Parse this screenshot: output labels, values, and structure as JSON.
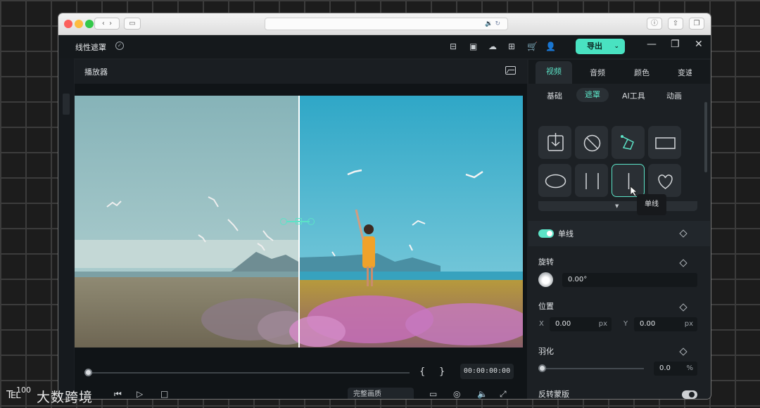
{
  "browser": {
    "url_icons": "🔉 ↻"
  },
  "app": {
    "title": "线性遮罩",
    "export_label": "导出",
    "export_chevron": "⌄"
  },
  "player": {
    "title": "播放器",
    "timecode": "00:00:00:00",
    "brace_left": "{",
    "brace_right": "}",
    "quality": "完整画质"
  },
  "panel": {
    "tabs": [
      {
        "label": "视频",
        "active": true
      },
      {
        "label": "音频",
        "active": false
      },
      {
        "label": "颜色",
        "active": false
      },
      {
        "label": "变速",
        "active": false
      }
    ],
    "subtabs": [
      {
        "label": "基础",
        "active": false
      },
      {
        "label": "遮罩",
        "active": true
      },
      {
        "label": "AI工具",
        "active": false
      },
      {
        "label": "动画",
        "active": false
      }
    ],
    "shapes": [
      {
        "icon": "import-icon"
      },
      {
        "icon": "none-icon"
      },
      {
        "icon": "pen-icon"
      },
      {
        "icon": "rectangle-icon"
      },
      {
        "icon": "ellipse-icon"
      },
      {
        "icon": "double-line-icon"
      },
      {
        "icon": "single-line-icon",
        "selected": true
      },
      {
        "icon": "heart-icon"
      }
    ],
    "tooltip": "单线",
    "mask_name": "单线",
    "rotation": {
      "label": "旋转",
      "value": "0.00°"
    },
    "position": {
      "label": "位置",
      "x_label": "X",
      "x_value": "0.00",
      "y_label": "Y",
      "y_value": "0.00",
      "unit": "px"
    },
    "feather": {
      "label": "羽化",
      "value": "0.0",
      "unit": "%",
      "level": 0
    },
    "invert": {
      "label": "反转蒙版",
      "enabled": false
    }
  },
  "colors": {
    "accent": "#5ce3c7",
    "export_bg": "#49e2c1"
  },
  "watermark": {
    "logo": "100",
    "text": "大数跨境"
  }
}
